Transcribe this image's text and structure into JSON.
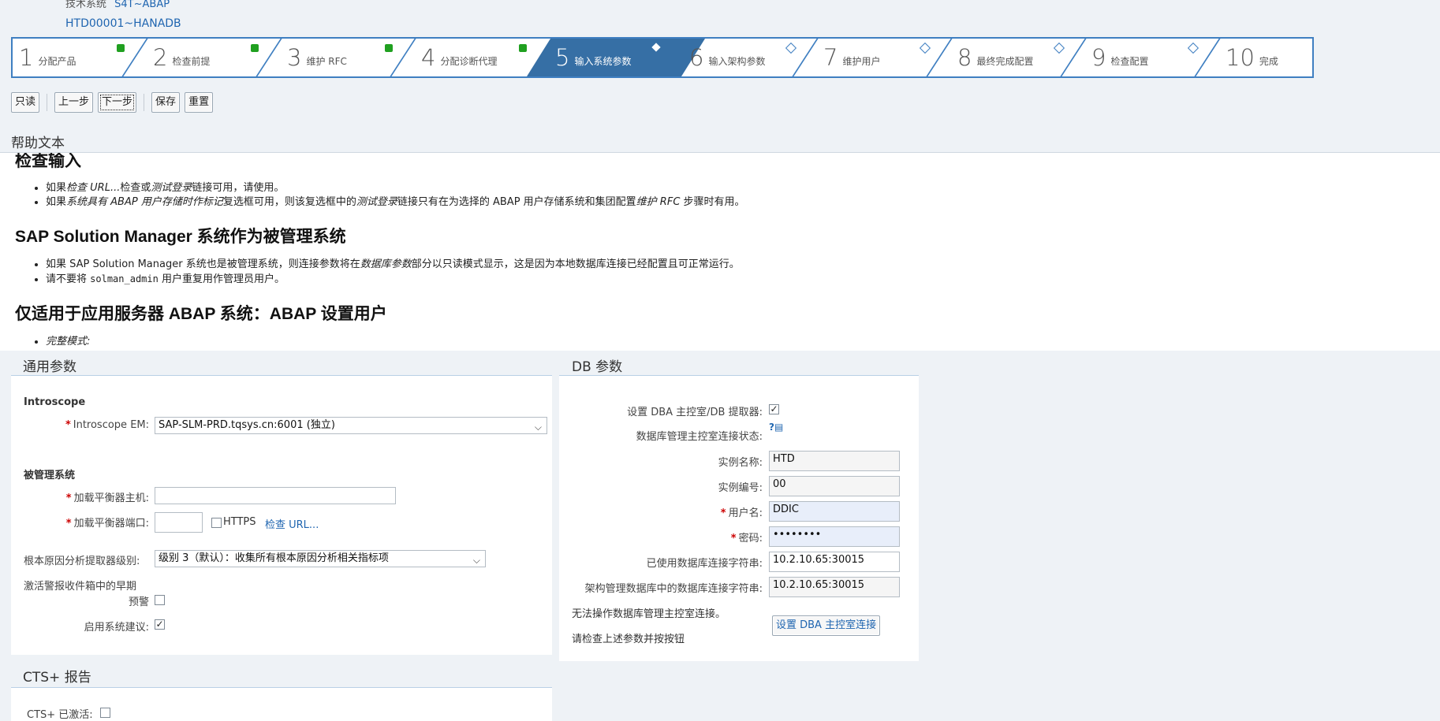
{
  "header": {
    "tech_system_label": "技术系统",
    "tech_system_value": "S4T~ABAP",
    "system_id": "HTD00001~HANADB"
  },
  "roadmap": [
    {
      "num": "1",
      "label": "分配产品",
      "state": "done"
    },
    {
      "num": "2",
      "label": "检查前提",
      "state": "done"
    },
    {
      "num": "3",
      "label": "维护 RFC",
      "state": "done"
    },
    {
      "num": "4",
      "label": "分配诊断代理",
      "state": "done"
    },
    {
      "num": "5",
      "label": "输入系统参数",
      "state": "current"
    },
    {
      "num": "6",
      "label": "输入架构参数",
      "state": "open"
    },
    {
      "num": "7",
      "label": "维护用户",
      "state": "open"
    },
    {
      "num": "8",
      "label": "最终完成配置",
      "state": "open"
    },
    {
      "num": "9",
      "label": "检查配置",
      "state": "open"
    },
    {
      "num": "10",
      "label": "完成",
      "state": "none"
    }
  ],
  "toolbar": {
    "readonly": "只读",
    "prev": "上一步",
    "next": "下一步",
    "save": "保存",
    "reset": "重置"
  },
  "help": {
    "title": "帮助文本",
    "h_check": "检查输入",
    "b1_pre": "如果",
    "b1_i1": "检查 URL...",
    "b1_mid": "检查或",
    "b1_i2": "测试登录",
    "b1_post": "链接可用，请使用。",
    "b2_pre": "如果",
    "b2_i1": "系统具有 ABAP 用户存储时作标记",
    "b2_mid": "复选框可用，则该复选框中的",
    "b2_i2": "测试登录",
    "b2_mid2": "链接只有在为选择的 ABAP 用户存储系统和集团配置",
    "b2_i3": "维护 RFC",
    "b2_post": " 步骤时有用。",
    "h_solman": "SAP Solution Manager 系统作为被管理系统",
    "b3_pre": "如果 SAP Solution Manager 系统也是被管理系统，则连接参数将在",
    "b3_i": "数据库参数",
    "b3_post": "部分以只读模式显示，这是因为本地数据库连接已经配置且可正常运行。",
    "b4_pre": "请不要将 ",
    "b4_code": "solman_admin",
    "b4_post": " 用户重复用作管理员用户。",
    "h_abap": "仅适用于应用服务器 ABAP 系统：ABAP 设置用户",
    "b5": "完整模式:"
  },
  "general": {
    "title": "通用参数",
    "introscope_section": "Introscope",
    "em_label": "Introscope EM:",
    "em_value": "SAP-SLM-PRD.tqsys.cn:6001 (独立)",
    "managed_section": "被管理系统",
    "lb_host_label": "加载平衡器主机:",
    "lb_host_value": "",
    "lb_port_label": "加载平衡器端口:",
    "lb_port_value": "",
    "https_label": "HTTPS",
    "https_checked": false,
    "check_url": "检查 URL...",
    "rca_label": "根本原因分析提取器级别:",
    "rca_value": "级别 3（默认）：收集所有根本原因分析相关指标项",
    "early_warn_label1": "激活警报收件箱中的早期",
    "early_warn_label2": "预警",
    "early_warn_checked": false,
    "sys_rec_label": "启用系统建议:",
    "sys_rec_checked": true
  },
  "db": {
    "title": "DB 参数",
    "dba_extractor_label": "设置 DBA 主控室/DB 提取器:",
    "dba_extractor_checked": true,
    "dba_status_label": "数据库管理主控室连接状态:",
    "status_icon": "question-db-icon",
    "instance_name_label": "实例名称:",
    "instance_name_value": "HTD",
    "instance_no_label": "实例编号:",
    "instance_no_value": "00",
    "user_label": "用户名:",
    "user_value": "DDIC",
    "password_label": "密码:",
    "password_value": "••••••••",
    "used_conn_label": "已使用数据库连接字符串:",
    "used_conn_value": "10.2.10.65:30015",
    "lmdb_conn_label": "架构管理数据库中的数据库连接字符串:",
    "lmdb_conn_value": "10.2.10.65:30015",
    "msg1": "无法操作数据库管理主控室连接。",
    "msg2": "请检查上述参数并按按钮",
    "dba_button": "设置 DBA 主控室连接"
  },
  "cts": {
    "title": "CTS+ 报告",
    "active_label": "CTS+ 已激活:",
    "active_checked": false
  }
}
